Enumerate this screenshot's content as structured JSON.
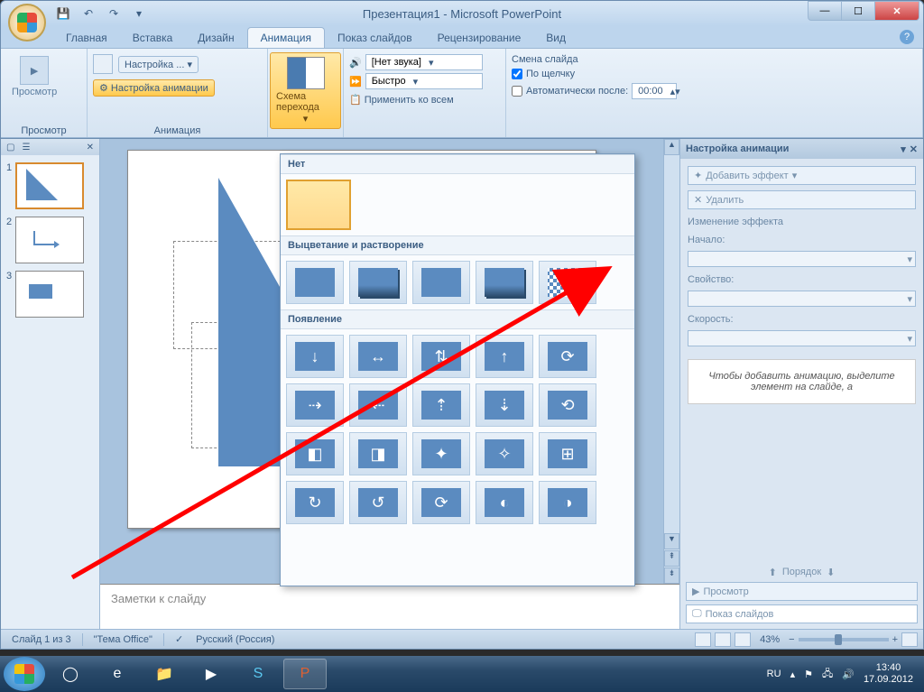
{
  "title": "Презентация1 - Microsoft PowerPoint",
  "tabs": {
    "home": "Главная",
    "insert": "Вставка",
    "design": "Дизайн",
    "animation": "Анимация",
    "slideshow": "Показ слайдов",
    "review": "Рецензирование",
    "view": "Вид"
  },
  "ribbon": {
    "preview_group": "Просмотр",
    "preview_btn": "Просмотр",
    "animation_group": "Анимация",
    "settings_dd": "Настройка ...",
    "anim_settings": "Настройка анимации",
    "scheme": "Схема перехода",
    "sound_combo": "[Нет звука]",
    "speed_combo": "Быстро",
    "apply_all": "Применить ко всем",
    "transition_label": "Смена слайда",
    "on_click": "По щелчку",
    "auto_after": "Автоматически после:",
    "auto_time": "00:00"
  },
  "gallery": {
    "none": "Нет",
    "fade": "Выцветание и растворение",
    "appear": "Появление"
  },
  "slides": {
    "s1": "1",
    "s2": "2",
    "s3": "3"
  },
  "notes_placeholder": "Заметки к слайду",
  "task_pane": {
    "title": "Настройка анимации",
    "add_effect": "Добавить эффект",
    "remove": "Удалить",
    "change_effect": "Изменение эффекта",
    "start": "Начало:",
    "property": "Свойство:",
    "speed": "Скорость:",
    "hint": "Чтобы добавить анимацию, выделите элемент на слайде, а",
    "order": "Порядок",
    "preview": "Просмотр",
    "slideshow": "Показ слайдов"
  },
  "statusbar": {
    "slide_of": "Слайд 1 из 3",
    "theme": "\"Тема Office\"",
    "lang": "Русский (Россия)",
    "zoom": "43%"
  },
  "systray": {
    "lang": "RU",
    "time": "13:40",
    "date": "17.09.2012"
  }
}
